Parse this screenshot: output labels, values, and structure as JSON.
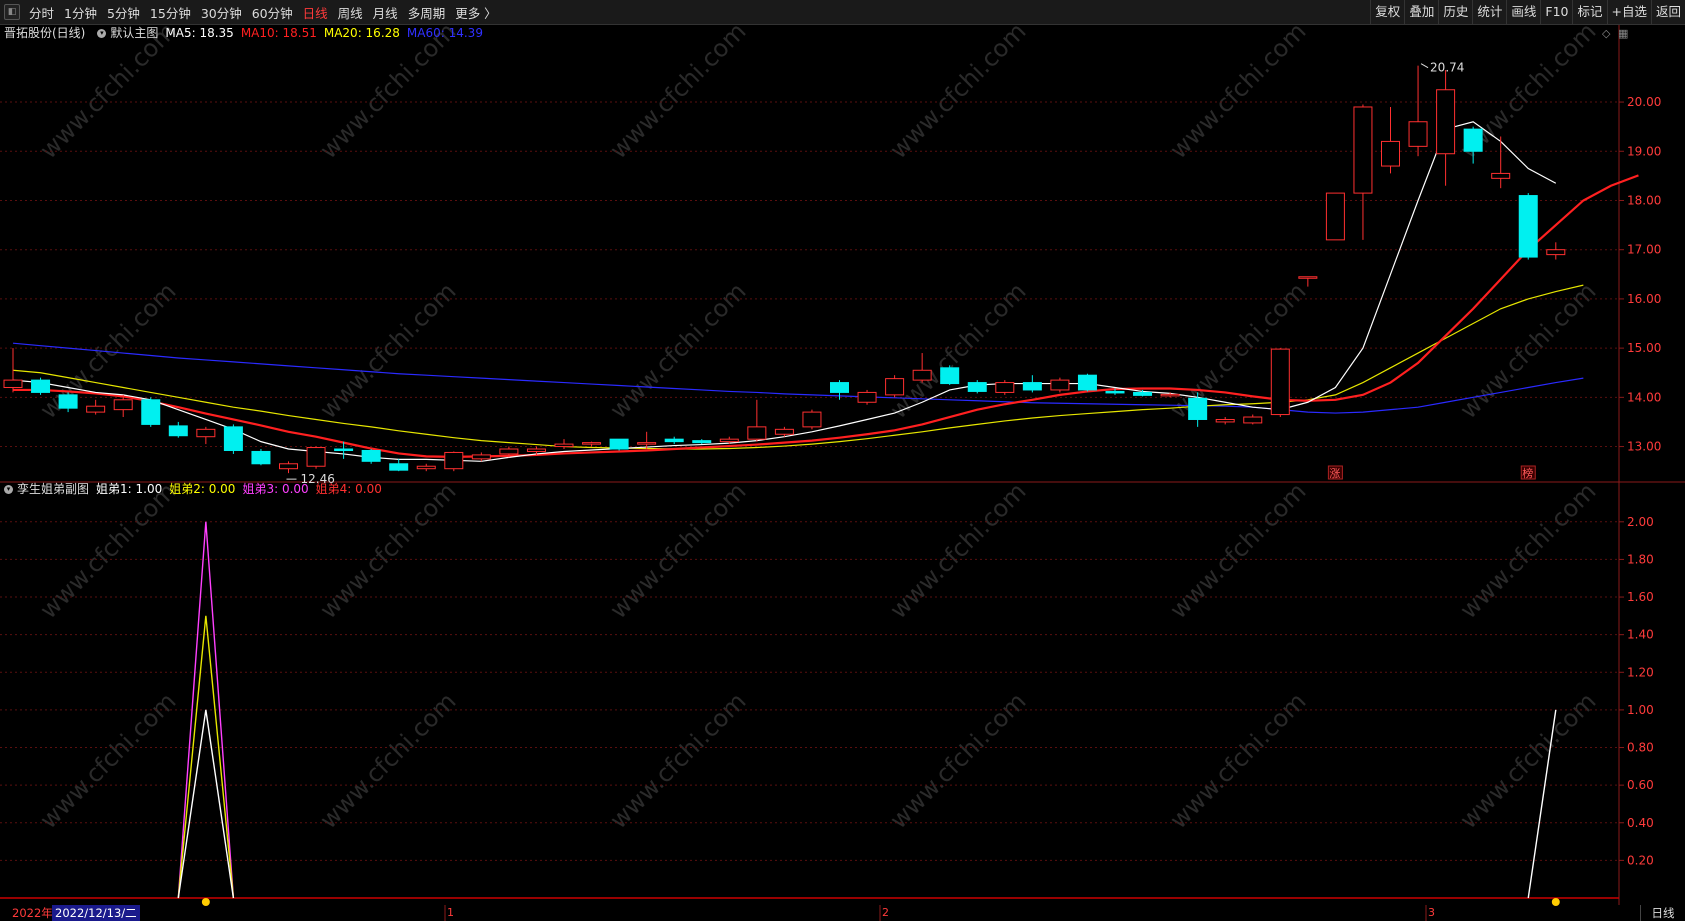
{
  "toolbar": {
    "tabs": [
      "分时",
      "1分钟",
      "5分钟",
      "15分钟",
      "30分钟",
      "60分钟",
      "日线",
      "周线",
      "月线",
      "多周期",
      "更多 〉"
    ],
    "active_tab": "日线",
    "right_buttons": [
      "复权",
      "叠加",
      "历史",
      "统计",
      "画线",
      "F10",
      "标记",
      "+自选",
      "返回"
    ]
  },
  "main_legend": {
    "stock": "晋拓股份(日线)",
    "template": "默认主图",
    "ma5": "MA5: 18.35",
    "ma10": "MA10: 18.51",
    "ma20": "MA20: 16.28",
    "ma60": "MA60: 14.39",
    "colors": {
      "ma5": "#ffffff",
      "ma10": "#ff2020",
      "ma20": "#ffff00",
      "ma60": "#3030ff"
    }
  },
  "sub_legend": {
    "name": "孪生姐弟副图",
    "s1": "姐弟1: 1.00",
    "s2": "姐弟2: 0.00",
    "s3": "姐弟3: 0.00",
    "s4": "姐弟4: 0.00",
    "colors": {
      "s1": "#ffffff",
      "s2": "#ffff00",
      "s3": "#ff40ff",
      "s4": "#ff3030"
    }
  },
  "annotations": {
    "high": "20.74",
    "low": "12.46",
    "marker1": "涨",
    "marker2": "榜"
  },
  "dates": {
    "year_label": "2022年",
    "cursor_date": "2022/12/13/二",
    "period": "日线",
    "month_ticks": [
      "1",
      "2",
      "3"
    ]
  },
  "watermark": "www.cfchi.com",
  "chart_data": [
    {
      "type": "candlestick",
      "title": "晋拓股份(日线)",
      "ylim": [
        12.3,
        21.2
      ],
      "yticks": [
        13.0,
        14.0,
        15.0,
        16.0,
        17.0,
        18.0,
        19.0,
        20.0
      ],
      "candles": [
        {
          "o": 14.2,
          "h": 15.0,
          "l": 14.1,
          "c": 14.35
        },
        {
          "o": 14.35,
          "h": 14.4,
          "l": 14.05,
          "c": 14.1
        },
        {
          "o": 14.05,
          "h": 14.1,
          "l": 13.7,
          "c": 13.78
        },
        {
          "o": 13.7,
          "h": 13.95,
          "l": 13.65,
          "c": 13.82
        },
        {
          "o": 13.75,
          "h": 14.05,
          "l": 13.6,
          "c": 13.95
        },
        {
          "o": 13.95,
          "h": 14.0,
          "l": 13.4,
          "c": 13.45
        },
        {
          "o": 13.42,
          "h": 13.5,
          "l": 13.18,
          "c": 13.22
        },
        {
          "o": 13.2,
          "h": 13.4,
          "l": 13.05,
          "c": 13.35
        },
        {
          "o": 13.4,
          "h": 13.45,
          "l": 12.85,
          "c": 12.92
        },
        {
          "o": 12.9,
          "h": 12.95,
          "l": 12.62,
          "c": 12.65
        },
        {
          "o": 12.55,
          "h": 12.7,
          "l": 12.46,
          "c": 12.65
        },
        {
          "o": 12.6,
          "h": 13.0,
          "l": 12.55,
          "c": 12.98
        },
        {
          "o": 12.95,
          "h": 13.1,
          "l": 12.75,
          "c": 12.92
        },
        {
          "o": 12.92,
          "h": 12.95,
          "l": 12.65,
          "c": 12.7
        },
        {
          "o": 12.65,
          "h": 12.75,
          "l": 12.5,
          "c": 12.52
        },
        {
          "o": 12.55,
          "h": 12.65,
          "l": 12.5,
          "c": 12.6
        },
        {
          "o": 12.55,
          "h": 12.9,
          "l": 12.5,
          "c": 12.88
        },
        {
          "o": 12.75,
          "h": 12.88,
          "l": 12.7,
          "c": 12.83
        },
        {
          "o": 12.85,
          "h": 13.0,
          "l": 12.78,
          "c": 12.95
        },
        {
          "o": 12.9,
          "h": 13.0,
          "l": 12.82,
          "c": 12.95
        },
        {
          "o": 13.0,
          "h": 13.15,
          "l": 12.95,
          "c": 13.05
        },
        {
          "o": 13.05,
          "h": 13.1,
          "l": 13.0,
          "c": 13.08
        },
        {
          "o": 13.15,
          "h": 13.15,
          "l": 12.92,
          "c": 12.95
        },
        {
          "o": 13.05,
          "h": 13.3,
          "l": 12.95,
          "c": 13.08
        },
        {
          "o": 13.15,
          "h": 13.2,
          "l": 13.05,
          "c": 13.1
        },
        {
          "o": 13.12,
          "h": 13.15,
          "l": 13.05,
          "c": 13.08
        },
        {
          "o": 13.1,
          "h": 13.2,
          "l": 13.05,
          "c": 13.15
        },
        {
          "o": 13.15,
          "h": 13.95,
          "l": 13.1,
          "c": 13.4
        },
        {
          "o": 13.25,
          "h": 13.4,
          "l": 13.2,
          "c": 13.35
        },
        {
          "o": 13.4,
          "h": 13.75,
          "l": 13.35,
          "c": 13.7
        },
        {
          "o": 14.3,
          "h": 14.35,
          "l": 13.95,
          "c": 14.1
        },
        {
          "o": 13.9,
          "h": 14.15,
          "l": 13.85,
          "c": 14.1
        },
        {
          "o": 14.05,
          "h": 14.45,
          "l": 14.0,
          "c": 14.38
        },
        {
          "o": 14.35,
          "h": 14.9,
          "l": 14.3,
          "c": 14.55
        },
        {
          "o": 14.6,
          "h": 14.65,
          "l": 14.25,
          "c": 14.28
        },
        {
          "o": 14.3,
          "h": 14.35,
          "l": 14.08,
          "c": 14.12
        },
        {
          "o": 14.1,
          "h": 14.35,
          "l": 14.05,
          "c": 14.3
        },
        {
          "o": 14.3,
          "h": 14.45,
          "l": 14.1,
          "c": 14.15
        },
        {
          "o": 14.15,
          "h": 14.4,
          "l": 14.1,
          "c": 14.35
        },
        {
          "o": 14.45,
          "h": 14.48,
          "l": 14.12,
          "c": 14.15
        },
        {
          "o": 14.12,
          "h": 14.18,
          "l": 14.05,
          "c": 14.1
        },
        {
          "o": 14.1,
          "h": 14.15,
          "l": 14.02,
          "c": 14.04
        },
        {
          "o": 14.05,
          "h": 14.1,
          "l": 14.0,
          "c": 14.06
        },
        {
          "o": 13.98,
          "h": 14.1,
          "l": 13.4,
          "c": 13.55
        },
        {
          "o": 13.5,
          "h": 13.6,
          "l": 13.45,
          "c": 13.55
        },
        {
          "o": 13.48,
          "h": 13.65,
          "l": 13.45,
          "c": 13.6
        },
        {
          "o": 13.65,
          "h": 15.0,
          "l": 13.6,
          "c": 14.98
        },
        {
          "o": 16.45,
          "h": 16.45,
          "l": 16.25,
          "c": 16.45
        },
        {
          "o": 17.2,
          "h": 18.15,
          "l": 17.2,
          "c": 18.15
        },
        {
          "o": 18.15,
          "h": 19.95,
          "l": 17.2,
          "c": 19.9
        },
        {
          "o": 18.7,
          "h": 19.9,
          "l": 18.55,
          "c": 19.2
        },
        {
          "o": 19.1,
          "h": 20.74,
          "l": 18.9,
          "c": 19.6
        },
        {
          "o": 18.95,
          "h": 20.65,
          "l": 18.3,
          "c": 20.25
        },
        {
          "o": 19.45,
          "h": 19.5,
          "l": 18.75,
          "c": 19.0
        },
        {
          "o": 18.45,
          "h": 19.3,
          "l": 18.25,
          "c": 18.55
        },
        {
          "o": 18.1,
          "h": 18.15,
          "l": 16.8,
          "c": 16.85
        },
        {
          "o": 16.9,
          "h": 17.15,
          "l": 16.8,
          "c": 17.0
        }
      ],
      "series": [
        {
          "name": "MA5",
          "values": [
            14.35,
            14.3,
            14.2,
            14.1,
            14.05,
            13.95,
            13.75,
            13.55,
            13.35,
            13.1,
            12.95,
            12.9,
            12.85,
            12.78,
            12.74,
            12.74,
            12.72,
            12.7,
            12.78,
            12.85,
            12.9,
            12.93,
            12.96,
            12.99,
            13.02,
            13.04,
            13.07,
            13.12,
            13.2,
            13.3,
            13.42,
            13.55,
            13.68,
            13.9,
            14.15,
            14.25,
            14.28,
            14.28,
            14.28,
            14.28,
            14.2,
            14.12,
            14.08,
            14.0,
            13.9,
            13.8,
            13.75,
            13.9,
            14.2,
            15.0,
            16.5,
            18.0,
            19.45,
            19.6,
            19.2,
            18.65,
            18.35
          ]
        },
        {
          "name": "MA10",
          "values": [
            14.15,
            14.15,
            14.12,
            14.08,
            14.02,
            13.92,
            13.8,
            13.67,
            13.55,
            13.43,
            13.3,
            13.2,
            13.08,
            12.96,
            12.86,
            12.8,
            12.79,
            12.8,
            12.81,
            12.83,
            12.86,
            12.88,
            12.9,
            12.92,
            12.95,
            12.98,
            13.01,
            13.04,
            13.08,
            13.12,
            13.18,
            13.25,
            13.33,
            13.45,
            13.6,
            13.75,
            13.86,
            13.95,
            14.05,
            14.12,
            14.17,
            14.18,
            14.18,
            14.15,
            14.1,
            14.02,
            13.95,
            13.93,
            13.95,
            14.05,
            14.3,
            14.7,
            15.25,
            15.8,
            16.4,
            17.0,
            17.5,
            18.0,
            18.3,
            18.51
          ]
        },
        {
          "name": "MA20",
          "values": [
            14.55,
            14.5,
            14.4,
            14.3,
            14.2,
            14.1,
            14.0,
            13.9,
            13.8,
            13.72,
            13.63,
            13.55,
            13.47,
            13.4,
            13.32,
            13.25,
            13.18,
            13.12,
            13.08,
            13.04,
            13.0,
            12.98,
            12.97,
            12.96,
            12.95,
            12.95,
            12.96,
            12.98,
            13.01,
            13.05,
            13.1,
            13.16,
            13.23,
            13.3,
            13.38,
            13.45,
            13.52,
            13.58,
            13.63,
            13.67,
            13.71,
            13.75,
            13.78,
            13.82,
            13.85,
            13.87,
            13.9,
            13.95,
            14.05,
            14.3,
            14.6,
            14.9,
            15.2,
            15.5,
            15.8,
            16.0,
            16.15,
            16.28
          ]
        },
        {
          "name": "MA60",
          "values": [
            15.1,
            15.05,
            15.0,
            14.95,
            14.9,
            14.85,
            14.8,
            14.76,
            14.72,
            14.68,
            14.64,
            14.6,
            14.56,
            14.52,
            14.48,
            14.45,
            14.42,
            14.39,
            14.36,
            14.33,
            14.3,
            14.27,
            14.24,
            14.21,
            14.18,
            14.15,
            14.12,
            14.1,
            14.07,
            14.05,
            14.03,
            14.01,
            13.99,
            13.97,
            13.95,
            13.93,
            13.91,
            13.89,
            13.88,
            13.87,
            13.86,
            13.85,
            13.84,
            13.83,
            13.82,
            13.8,
            13.75,
            13.7,
            13.68,
            13.7,
            13.75,
            13.8,
            13.9,
            14.0,
            14.1,
            14.2,
            14.3,
            14.39
          ]
        }
      ]
    },
    {
      "type": "line",
      "title": "孪生姐弟副图",
      "ylim": [
        0,
        2.1
      ],
      "yticks": [
        0.2,
        0.4,
        0.6,
        0.8,
        1.0,
        1.2,
        1.4,
        1.6,
        1.8,
        2.0
      ],
      "series": [
        {
          "name": "姐弟1",
          "points": [
            [
              6,
              0
            ],
            [
              7,
              1
            ],
            [
              8,
              0
            ],
            [
              55,
              0
            ],
            [
              56,
              1
            ]
          ]
        },
        {
          "name": "姐弟2",
          "points": [
            [
              6,
              0
            ],
            [
              7,
              1.5
            ],
            [
              8,
              0
            ]
          ]
        },
        {
          "name": "姐弟3",
          "points": [
            [
              6,
              0
            ],
            [
              7,
              2
            ],
            [
              8,
              0
            ]
          ]
        }
      ]
    }
  ]
}
